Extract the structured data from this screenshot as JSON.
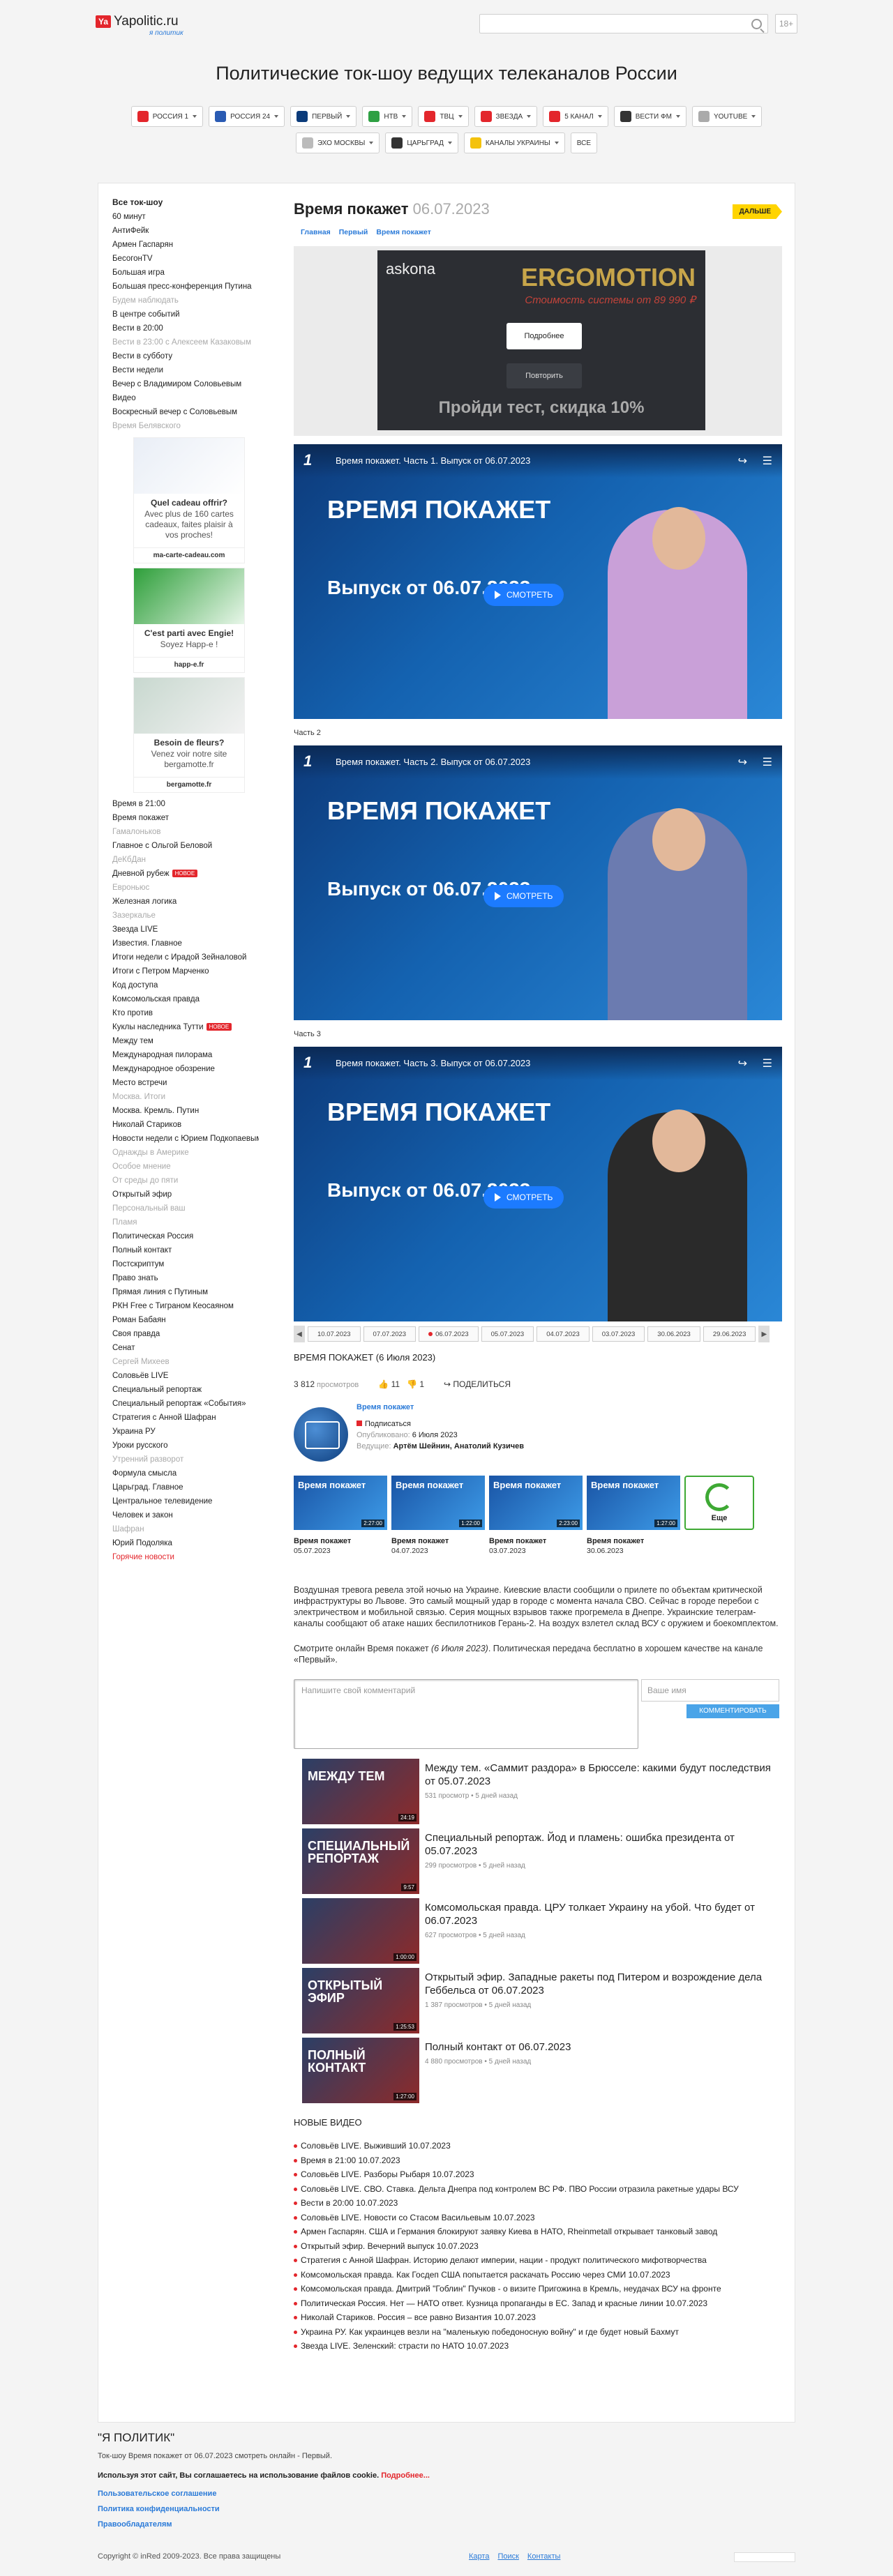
{
  "header": {
    "logo_badge": "Ya",
    "logo_text": "Yapolitic.ru",
    "logo_sub": "я политик",
    "age": "18+"
  },
  "page_title": "Политические ток-шоу ведущих телеканалов России",
  "channels": [
    {
      "label": "Россия 1",
      "color": "#e3262c"
    },
    {
      "label": "Россия 24",
      "color": "#2a5bb3"
    },
    {
      "label": "Первый",
      "color": "#0b3b7a"
    },
    {
      "label": "НТВ",
      "color": "#2ea043"
    },
    {
      "label": "ТВЦ",
      "color": "#e3262c"
    },
    {
      "label": "Звезда",
      "color": "#e3262c"
    },
    {
      "label": "5 канал",
      "color": "#e3262c"
    },
    {
      "label": "Вести ФМ",
      "color": "#333333"
    },
    {
      "label": "YouTube",
      "color": "#aaaaaa"
    },
    {
      "label": "Эхо Москвы",
      "color": "#bbbbbb"
    },
    {
      "label": "Царьград",
      "color": "#333333"
    },
    {
      "label": "Каналы Украины",
      "color": "#f4c20d"
    },
    {
      "label": "Все",
      "color": ""
    }
  ],
  "sidebar": {
    "title": "Все ток-шоу",
    "items_top": [
      {
        "t": "60 минут",
        "c": ""
      },
      {
        "t": "АнтиФейк",
        "c": ""
      },
      {
        "t": "Армен Гаспарян",
        "c": ""
      },
      {
        "t": "БесогонTV",
        "c": ""
      },
      {
        "t": "Большая игра",
        "c": ""
      },
      {
        "t": "Большая пресс-конференция Путина",
        "c": ""
      },
      {
        "t": "Будем наблюдать",
        "c": "gray"
      },
      {
        "t": "В центре событий",
        "c": ""
      },
      {
        "t": "Вести в 20:00",
        "c": ""
      },
      {
        "t": "Вести в 23:00 с Алексеем Казаковым",
        "c": "gray"
      },
      {
        "t": "Вести в субботу",
        "c": ""
      },
      {
        "t": "Вести недели",
        "c": ""
      },
      {
        "t": "Вечер с Владимиром Соловьевым",
        "c": ""
      },
      {
        "t": "Видео",
        "c": ""
      },
      {
        "t": "Воскресный вечер с Соловьевым",
        "c": ""
      },
      {
        "t": "Время Белявского",
        "c": "gray"
      }
    ],
    "ads": [
      {
        "title": "Quel cadeau offrir?",
        "desc": "Avec plus de 160 cartes cadeaux, faites plaisir à vos proches!",
        "url": "ma-carte-cadeau.com"
      },
      {
        "title": "C'est parti avec Engie!",
        "desc": "Soyez Happ-e !",
        "url": "happ-e.fr"
      },
      {
        "title": "Besoin de fleurs?",
        "desc": "Venez voir notre site bergamotte.fr",
        "url": "bergamotte.fr"
      }
    ],
    "items_bottom": [
      {
        "t": "Время в 21:00",
        "c": ""
      },
      {
        "t": "Время покажет",
        "c": ""
      },
      {
        "t": "Гамалоньков",
        "c": "gray"
      },
      {
        "t": "Главное с Ольгой Беловой",
        "c": ""
      },
      {
        "t": "ДеКбДан",
        "c": "gray"
      },
      {
        "t": "Дневной рубеж",
        "c": "",
        "badge": "НОВОЕ"
      },
      {
        "t": "Евроньюс",
        "c": "gray"
      },
      {
        "t": "Железная логика",
        "c": ""
      },
      {
        "t": "Зазеркалье",
        "c": "gray"
      },
      {
        "t": "Звезда LIVE",
        "c": ""
      },
      {
        "t": "Известия. Главное",
        "c": ""
      },
      {
        "t": "Итоги недели с Ирадой Зейналовой",
        "c": ""
      },
      {
        "t": "Итоги с Петром Марченко",
        "c": ""
      },
      {
        "t": "Код доступа",
        "c": ""
      },
      {
        "t": "Комсомольская правда",
        "c": ""
      },
      {
        "t": "Кто против",
        "c": ""
      },
      {
        "t": "Куклы наследника Тутти",
        "c": "",
        "badge": "НОВОЕ"
      },
      {
        "t": "Между тем",
        "c": ""
      },
      {
        "t": "Международная пилорама",
        "c": ""
      },
      {
        "t": "Международное обозрение",
        "c": ""
      },
      {
        "t": "Место встречи",
        "c": ""
      },
      {
        "t": "Москва. Итоги",
        "c": "gray"
      },
      {
        "t": "Москва. Кремль. Путин",
        "c": ""
      },
      {
        "t": "Николай Стариков",
        "c": ""
      },
      {
        "t": "Новости недели с Юрием Подкопаевым",
        "c": ""
      },
      {
        "t": "Однажды в Америке",
        "c": "gray"
      },
      {
        "t": "Особое мнение",
        "c": "gray"
      },
      {
        "t": "От среды до пяти",
        "c": "gray"
      },
      {
        "t": "Открытый эфир",
        "c": ""
      },
      {
        "t": "Персональный ваш",
        "c": "gray"
      },
      {
        "t": "Пламя",
        "c": "gray"
      },
      {
        "t": "Политическая Россия",
        "c": ""
      },
      {
        "t": "Полный контакт",
        "c": ""
      },
      {
        "t": "Постскриптум",
        "c": ""
      },
      {
        "t": "Право знать",
        "c": ""
      },
      {
        "t": "Прямая линия с Путиным",
        "c": ""
      },
      {
        "t": "РКН Free с Тиграном Кеосаяном",
        "c": ""
      },
      {
        "t": "Роман Бабаян",
        "c": ""
      },
      {
        "t": "Своя правда",
        "c": ""
      },
      {
        "t": "Сенат",
        "c": ""
      },
      {
        "t": "Сергей Михеев",
        "c": "gray"
      },
      {
        "t": "Соловьёв LIVE",
        "c": ""
      },
      {
        "t": "Специальный репортаж",
        "c": ""
      },
      {
        "t": "Специальный репортаж «События»",
        "c": ""
      },
      {
        "t": "Стратегия с Анной Шафран",
        "c": ""
      },
      {
        "t": "Украина РУ",
        "c": ""
      },
      {
        "t": "Уроки русского",
        "c": ""
      },
      {
        "t": "Утренний разворот",
        "c": "gray"
      },
      {
        "t": "Формула смысла",
        "c": ""
      },
      {
        "t": "Царьград. Главное",
        "c": ""
      },
      {
        "t": "Центральное телевидение",
        "c": ""
      },
      {
        "t": "Человек и закон",
        "c": ""
      },
      {
        "t": "Шафран",
        "c": "gray"
      },
      {
        "t": "Юрий Подоляка",
        "c": ""
      },
      {
        "t": "Горячие новости",
        "c": "red"
      }
    ]
  },
  "content": {
    "title": "Время покажет",
    "date": "06.07.2023",
    "next": "ДАЛЬШЕ",
    "crumbs": [
      "Главная",
      "Первый",
      "Время покажет"
    ],
    "adbox": {
      "brand": "askona",
      "name": "ERGOMOTION",
      "sub": "Стоимость системы от 89 990 ₽",
      "more": "Подробнее",
      "repeat": "Повторить",
      "footer": "Пройди тест, скидка 10%"
    },
    "videos": [
      {
        "part": "",
        "title": "Время покажет. Часть 1. Выпуск от 06.07.2023",
        "big": "ВРЕМЯ ПОКАЖЕТ",
        "rel": "Выпуск от 06.07.2023",
        "watch": "СМОТРЕТЬ",
        "skin": "#c9a0d8"
      },
      {
        "part": "Часть 2",
        "title": "Время покажет. Часть 2. Выпуск от 06.07.2023",
        "big": "ВРЕМЯ ПОКАЖЕТ",
        "rel": "Выпуск от 06.07.2023",
        "watch": "СМОТРЕТЬ",
        "skin": "#6b7bb0"
      },
      {
        "part": "Часть 3",
        "title": "Время покажет. Часть 3. Выпуск от 06.07.2023",
        "big": "ВРЕМЯ ПОКАЖЕТ",
        "rel": "Выпуск от 06.07.2023",
        "watch": "СМОТРЕТЬ",
        "skin": "#2a2a2a"
      }
    ],
    "dates": [
      "10.07.2023",
      "07.07.2023",
      "06.07.2023",
      "05.07.2023",
      "04.07.2023",
      "03.07.2023",
      "30.06.2023",
      "29.06.2023"
    ],
    "current_date": "06.07.2023",
    "show_name": "ВРЕМЯ ПОКАЖЕТ (6 Июля 2023)",
    "views": "3 812",
    "views_label": "просмотров",
    "likes": "11",
    "dislikes": "1",
    "share": "ПОДЕЛИТЬСЯ",
    "author": {
      "name": "Время покажет",
      "subscribe": "Подписаться",
      "published_label": "Опубликовано:",
      "published": "6 Июля 2023",
      "hosts_label": "Ведущие:",
      "hosts": "Артём Шейнин, Анатолий Кузичев"
    },
    "related": [
      {
        "name": "Время покажет",
        "date": "05.07.2023",
        "dur": "2:27:00"
      },
      {
        "name": "Время покажет",
        "date": "04.07.2023",
        "dur": "1:22:00"
      },
      {
        "name": "Время покажет",
        "date": "03.07.2023",
        "dur": "2:23:00"
      },
      {
        "name": "Время покажет",
        "date": "30.06.2023",
        "dur": "1:27:00"
      }
    ],
    "more": "Еще",
    "desc": "Воздушная тревога ревела этой ночью на Украине. Киевские власти сообщили о прилете по объектам критической инфраструктуры во Львове. Это самый мощный удар в городе с момента начала СВО. Сейчас в городе перебои с электричеством и мобильной связью. Серия мощных взрывов также прогремела в Днепре. Украинские телеграм-каналы сообщают об атаке наших беспилотников Герань-2. На воздух взлетел склад ВСУ с оружием и боекомплектом.",
    "desc2_a": "Смотрите онлайн Время покажет ",
    "desc2_b": "(6 Июля 2023)",
    "desc2_c": ". Политическая передача бесплатно в хорошем качестве на канале «Первый».",
    "comment_placeholder": "Напишите свой комментарий",
    "name_placeholder": "Ваше имя",
    "comment_btn": "КОММЕНТИРОВАТЬ",
    "recommended": [
      {
        "title": "Между тем. «Саммит раздора» в Брюсселе: какими будут последствия от 05.07.2023",
        "views": "531 просмотр",
        "ago": "5 дней назад",
        "label": "МЕЖДУ ТЕМ",
        "dur": "24:19"
      },
      {
        "title": "Специальный репортаж. Йод и пламень: ошибка президента от 05.07.2023",
        "views": "299 просмотров",
        "ago": "5 дней назад",
        "label": "СПЕЦИАЛЬНЫЙ РЕПОРТАЖ",
        "dur": "9:57"
      },
      {
        "title": "Комсомольская правда. ЦРУ толкает Украину на убой. Что будет от 06.07.2023",
        "views": "627 просмотров",
        "ago": "5 дней назад",
        "label": "",
        "dur": "1:00:00"
      },
      {
        "title": "Открытый эфир. Западные ракеты под Питером и возрождение дела Геббельса от 06.07.2023",
        "views": "1 387 просмотров",
        "ago": "5 дней назад",
        "label": "ОТКРЫТЫЙ ЭФИР",
        "dur": "1:25:53"
      },
      {
        "title": "Полный контакт от 06.07.2023",
        "views": "4 880 просмотров",
        "ago": "5 дней назад",
        "label": "ПОЛНЫЙ КОНТАКТ",
        "dur": "1:27:00"
      }
    ],
    "new_videos_title": "НОВЫЕ ВИДЕО",
    "new_videos": [
      "Соловьёв LIVE. Выживший 10.07.2023",
      "Время в 21:00 10.07.2023",
      "Соловьёв LIVE. Разборы Рыбаря 10.07.2023",
      "Соловьёв LIVE. СВО. Ставка. Дельта Днепра под контролем ВС РФ. ПВО России отразила ракетные удары ВСУ",
      "Вести в 20:00 10.07.2023",
      "Соловьёв LIVE. Новости со Стасом Васильевым 10.07.2023",
      "Армен Гаспарян. США и Германия блокируют заявку Киева в НАТО, Rheinmetall открывает танковый завод",
      "Открытый эфир. Вечерний выпуск 10.07.2023",
      "Стратегия с Анной Шафран. Историю делают империи, нации - продукт политического мифотворчества",
      "Комсомольская правда. Как Госдеп США попытается раскачать Россию через СМИ 10.07.2023",
      "Комсомольская правда. Дмитрий \"Гоблин\" Пучков - о визите Пригожина в Кремль, неудачах ВСУ на фронте",
      "Политическая Россия. Нет — НАТО ответ. Кузница пропаганды в ЕС. Запад и красные линии 10.07.2023",
      "Николай Стариков. Россия – все равно Византия 10.07.2023",
      "Украина РУ. Как украинцев везли на \"маленькую победоносную войну\" и где будет новый Бахмут",
      "Звезда LIVE. Зеленский: страсти по НАТО 10.07.2023"
    ]
  },
  "footer": {
    "heading": "\"Я ПОЛИТИК\"",
    "line1": "Ток-шоу Время покажет от 06.07.2023 смотреть онлайн - Первый.",
    "cookie_a": "Используя этот сайт, Вы соглашаетесь на использование файлов cookie.",
    "cookie_b": "Подробнее...",
    "links": [
      "Пользовательское соглашение",
      "Политика конфиденциальности",
      "Правообладателям"
    ],
    "copyright": "Copyright © inRed 2009-2023. Все права защищены",
    "menu": [
      "Карта",
      "Поиск",
      "Контакты"
    ]
  }
}
